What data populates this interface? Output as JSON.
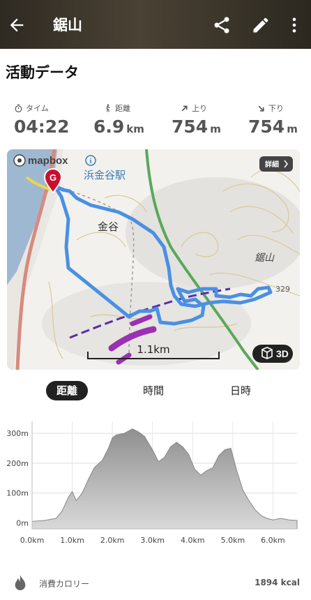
{
  "header": {
    "title": "鋸山"
  },
  "section_title": "活動データ",
  "stats": [
    {
      "label": "タイム",
      "value": "04:22",
      "unit": "",
      "icon": "stopwatch-icon"
    },
    {
      "label": "距離",
      "value": "6.9",
      "unit": "km",
      "icon": "hiker-icon"
    },
    {
      "label": "上り",
      "value": "754",
      "unit": "m",
      "icon": "arrow-up-right-icon"
    },
    {
      "label": "下り",
      "value": "754",
      "unit": "m",
      "icon": "arrow-down-right-icon"
    }
  ],
  "map": {
    "brand": "mapbox",
    "station_label": "浜金谷駅",
    "area_label": "金谷",
    "mountain_label": "鋸山",
    "summit_label": "329",
    "goal_marker": "G",
    "detail_button": "詳細",
    "scale_label": "1.1km",
    "view3d_button": "3D",
    "route_color": "#4a90e2"
  },
  "tabs": [
    {
      "label": "距離",
      "active": true
    },
    {
      "label": "時間",
      "active": false
    },
    {
      "label": "日時",
      "active": false
    }
  ],
  "chart_data": {
    "type": "area",
    "x": [
      0,
      0.3,
      0.6,
      0.75,
      0.9,
      1.0,
      1.1,
      1.25,
      1.4,
      1.55,
      1.75,
      1.9,
      2.0,
      2.1,
      2.3,
      2.5,
      2.65,
      2.8,
      3.0,
      3.15,
      3.3,
      3.45,
      3.6,
      3.75,
      3.9,
      4.05,
      4.2,
      4.35,
      4.5,
      4.65,
      4.8,
      4.95,
      5.1,
      5.25,
      5.4,
      5.55,
      5.7,
      5.85,
      6.0,
      6.2,
      6.4,
      6.6
    ],
    "y": [
      5,
      8,
      15,
      40,
      85,
      105,
      75,
      100,
      145,
      185,
      210,
      250,
      285,
      295,
      300,
      315,
      305,
      290,
      245,
      205,
      220,
      255,
      270,
      255,
      230,
      180,
      160,
      175,
      185,
      225,
      245,
      250,
      175,
      110,
      75,
      45,
      25,
      15,
      10,
      15,
      10,
      8
    ],
    "xlabel": "",
    "ylabel": "",
    "xlim": [
      0,
      6.6
    ],
    "ylim": [
      -20,
      340
    ],
    "xticks": [
      "0.0km",
      "1.0km",
      "2.0km",
      "3.0km",
      "4.0km",
      "5.0km",
      "6.0km"
    ],
    "yticks": [
      "0m",
      "100m",
      "200m",
      "300m"
    ],
    "xtick_values": [
      0,
      1,
      2,
      3,
      4,
      5,
      6
    ],
    "ytick_values": [
      0,
      100,
      200,
      300
    ],
    "grid": true,
    "fill_color": "#b5b5b5"
  },
  "footer": {
    "label": "消費カロリー",
    "value": "1894 kcal"
  }
}
